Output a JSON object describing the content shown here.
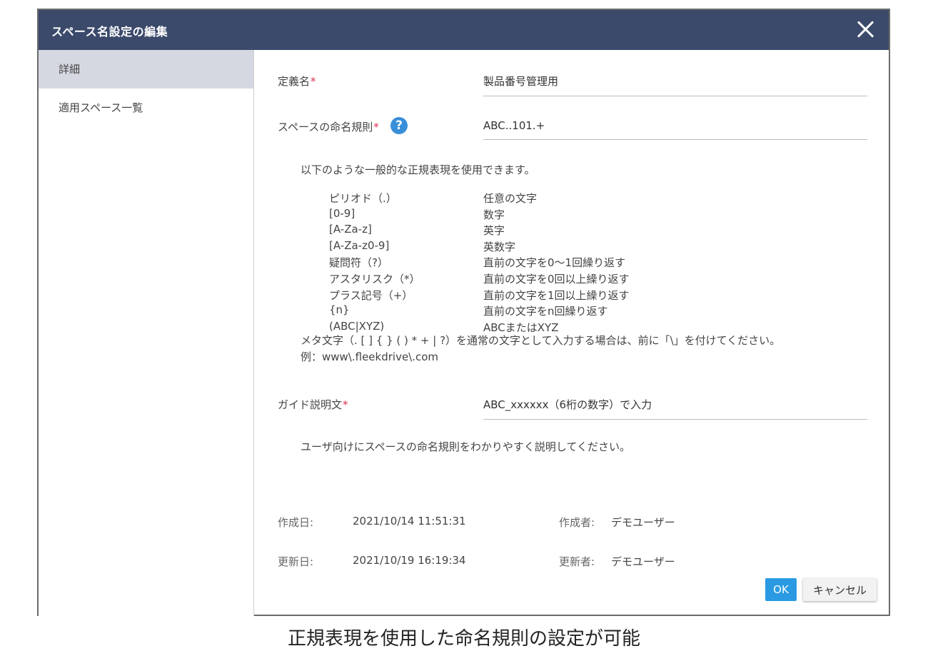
{
  "dialog": {
    "title": "スペース名設定の編集"
  },
  "sidebar": {
    "items": [
      {
        "label": "詳細"
      },
      {
        "label": "適用スペース一覧"
      }
    ]
  },
  "form": {
    "definition_name": {
      "label": "定義名",
      "required_mark": "*",
      "value": "製品番号管理用"
    },
    "naming_rule": {
      "label": "スペースの命名規則",
      "required_mark": "*",
      "value": "ABC..101.+",
      "help_icon": "?"
    },
    "regex_intro": "以下のような一般的な正規表現を使用できます。",
    "regex_rows": [
      {
        "symbol": "ピリオド（.）",
        "description": "任意の文字"
      },
      {
        "symbol": "[0-9]",
        "description": "数字"
      },
      {
        "symbol": "[A-Za-z]",
        "description": "英字"
      },
      {
        "symbol": "[A-Za-z0-9]",
        "description": "英数字"
      },
      {
        "symbol": "疑問符（?）",
        "description": "直前の文字を0〜1回繰り返す"
      },
      {
        "symbol": "アスタリスク（*）",
        "description": "直前の文字を0回以上繰り返す"
      },
      {
        "symbol": "プラス記号（+）",
        "description": "直前の文字を1回以上繰り返す"
      },
      {
        "symbol": "{n}",
        "description": "直前の文字をn回繰り返す"
      },
      {
        "symbol": "(ABC|XYZ)",
        "description": "ABCまたはXYZ"
      }
    ],
    "meta_note": "メタ文字（. [ ] { } ( ) * + | ?）を通常の文字として入力する場合は、前に「\\」を付けてください。",
    "example": "例：www\\.fleekdrive\\.com",
    "guide_text": {
      "label": "ガイド説明文",
      "required_mark": "*",
      "value": "ABC_xxxxxx（6桁の数字）で入力"
    },
    "guide_hint": "ユーザ向けにスペースの命名規則をわかりやすく説明してください。"
  },
  "meta": {
    "created_label": "作成日:",
    "created_value": "2021/10/14 11:51:31",
    "creator_label": "作成者:",
    "creator_value": "デモユーザー",
    "updated_label": "更新日:",
    "updated_value": "2021/10/19 16:19:34",
    "updater_label": "更新者:",
    "updater_value": "デモユーザー"
  },
  "buttons": {
    "ok": "OK",
    "cancel": "キャンセル"
  },
  "caption": "正規表現を使用した命名規則の設定が可能",
  "colors": {
    "titlebar": "#3b4a6b",
    "sidebar_active": "#d5d8e1",
    "ok_button": "#2a9be3",
    "required": "#d9304f",
    "help_icon": "#3a8fd9"
  },
  "icons": {
    "close": "close-icon",
    "help": "help-icon"
  }
}
